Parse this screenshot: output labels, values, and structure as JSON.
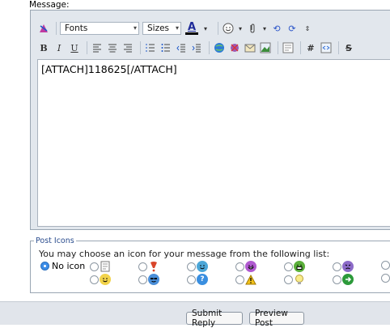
{
  "message_label": "Message:",
  "editor": {
    "font_combo": "Fonts",
    "size_combo": "Sizes",
    "content": "[ATTACH]118625[/ATTACH]"
  },
  "post_icons": {
    "legend": "Post Icons",
    "description": "You may choose an icon for your message from the following list:",
    "no_icon_label": "No icon",
    "selected": "No icon"
  },
  "footer": {
    "submit_label": "Submit Reply",
    "preview_label": "Preview Post"
  }
}
